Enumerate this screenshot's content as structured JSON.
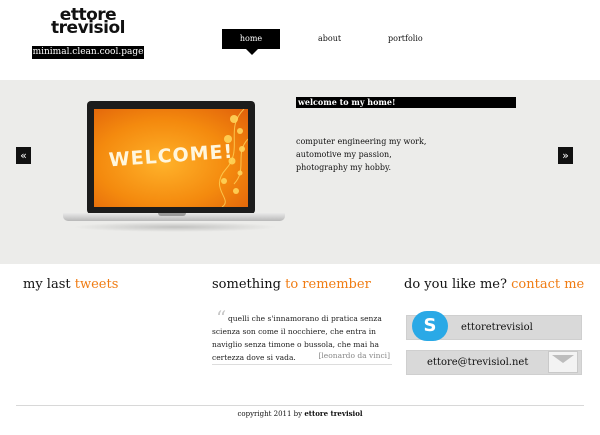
{
  "logo": {
    "name_line1": "ettore",
    "name_line2": "trevisiol",
    "tagline": "minimal.clean.cool.page"
  },
  "nav": {
    "items": [
      {
        "label": "home",
        "active": true
      },
      {
        "label": "about",
        "active": false
      },
      {
        "label": "portfolio",
        "active": false
      }
    ]
  },
  "slider": {
    "prev_icon": "double-chevron-left-icon",
    "next_icon": "double-chevron-right-icon",
    "prev_glyph": "«",
    "next_glyph": "»",
    "screen_text": "WELCOME!",
    "title": "welcome to my home!",
    "lines": [
      "computer engineering my work,",
      "automotive my passion,",
      "photography my hobby."
    ]
  },
  "columns": {
    "tweets": {
      "title": "my last ",
      "highlight": "tweets"
    },
    "remember": {
      "title": "something ",
      "highlight": "to remember"
    },
    "contact": {
      "title": "do you like me? ",
      "highlight": "contact me"
    }
  },
  "quote": {
    "mark": "“",
    "text": "quelli che s'innamorano di pratica senza scienza son come il nocchiere, che entra in naviglio senza timone o bussola, che mai ha certezza dove si vada.",
    "author": "[leonardo da vinci]"
  },
  "contact": {
    "skype_icon": "skype-icon",
    "skype_glyph": "S",
    "skype_id": "ettoretrevisiol",
    "email_icon": "envelope-icon",
    "email": "ettore@trevisiol.net"
  },
  "footer": {
    "prefix": "copyright 2011 by ",
    "owner": "ettore trevisiol"
  },
  "colors": {
    "accent": "#f07c13",
    "band": "#ececea",
    "nav_active": "#000000"
  }
}
